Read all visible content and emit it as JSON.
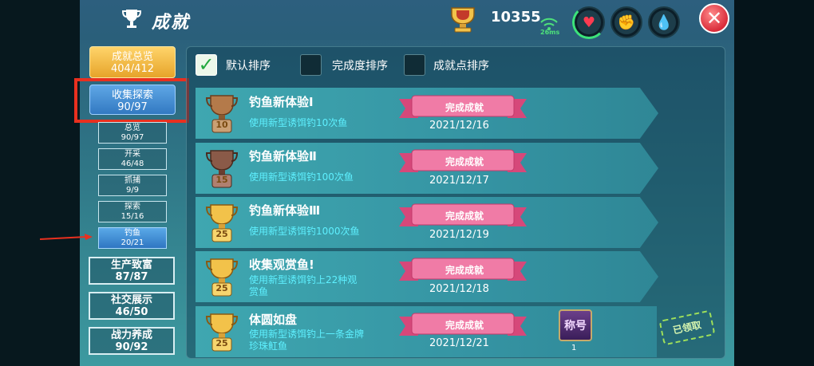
{
  "window": {
    "title": "成就"
  },
  "header": {
    "points": "10355",
    "ping": "26ms"
  },
  "colors": {
    "accent_gold": "#e6a42a",
    "selected_blue": "#3279c2",
    "highlight_red": "#e9301f",
    "desc_cyan": "#5ef0ff"
  },
  "nav": {
    "summary": {
      "label": "成就总览",
      "value": "404/412"
    },
    "collect": {
      "label": "收集探索",
      "value": "90/97"
    },
    "subs": [
      {
        "label": "总览",
        "value": "90/97"
      },
      {
        "label": "开采",
        "value": "46/48"
      },
      {
        "label": "抓捕",
        "value": "9/9"
      },
      {
        "label": "探索",
        "value": "15/16"
      },
      {
        "label": "钓鱼",
        "value": "20/21"
      }
    ],
    "cats": [
      {
        "label": "生产致富",
        "value": "87/87"
      },
      {
        "label": "社交展示",
        "value": "46/50"
      },
      {
        "label": "战力养成",
        "value": "90/92"
      }
    ]
  },
  "sort": {
    "options": [
      "默认排序",
      "完成度排序",
      "成就点排序"
    ],
    "selected": "默认排序"
  },
  "achievements": [
    {
      "title": "钓鱼新体验Ⅰ",
      "desc": "使用新型诱饵钓10次鱼",
      "points": "10",
      "status": "完成成就",
      "date": "2021/12/16"
    },
    {
      "title": "钓鱼新体验Ⅱ",
      "desc": "使用新型诱饵钓100次鱼",
      "points": "15",
      "status": "完成成就",
      "date": "2021/12/17"
    },
    {
      "title": "钓鱼新体验Ⅲ",
      "desc": "使用新型诱饵钓1000次鱼",
      "points": "25",
      "status": "完成成就",
      "date": "2021/12/19"
    },
    {
      "title": "收集观赏鱼!",
      "desc": "使用新型诱饵钓上22种观赏鱼",
      "desc_line1": "使用新型诱饵钓上22种观",
      "desc_line2": "赏鱼",
      "points": "25",
      "status": "完成成就",
      "date": "2021/12/18"
    },
    {
      "title": "体圆如盘",
      "desc_line1": "使用新型诱饵钓上一条金牌",
      "desc_line2": "珍珠魟鱼",
      "points": "25",
      "status": "完成成就",
      "date": "2021/12/21",
      "reward": {
        "label": "称号",
        "count": "1"
      },
      "claim_status": "已领取"
    }
  ]
}
